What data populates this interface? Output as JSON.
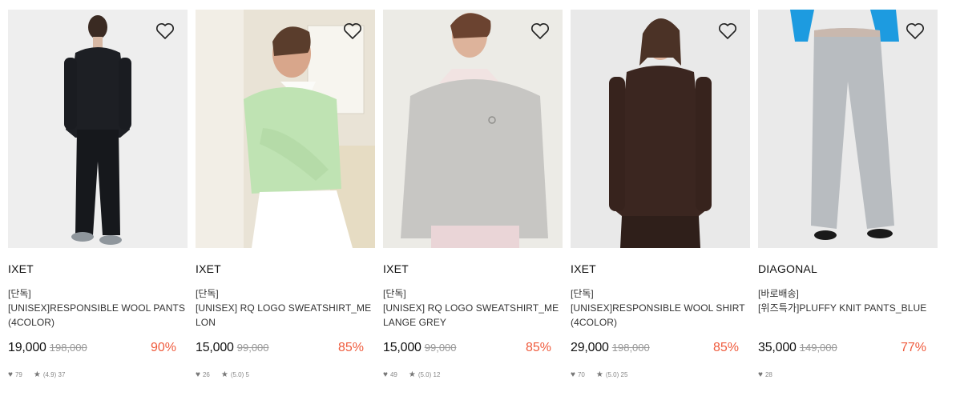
{
  "products": [
    {
      "brand": "IXET",
      "tag": "[단독]",
      "name": "[UNISEX]RESPONSIBLE WOOL PANTS (4COLOR)",
      "price": "19,000",
      "original_price": "198,000",
      "discount": "90%",
      "likes": "79",
      "rating": "(4.9)",
      "reviews": "37",
      "image": "model in black shirt and black wool pants"
    },
    {
      "brand": "IXET",
      "tag": "[단독]",
      "name": "[UNISEX] RQ LOGO SWEATSHIRT_MELON",
      "price": "15,000",
      "original_price": "99,000",
      "discount": "85%",
      "likes": "26",
      "rating": "(5.0)",
      "reviews": "5",
      "image": "model in melon green sweatshirt with white collar"
    },
    {
      "brand": "IXET",
      "tag": "[단독]",
      "name": "[UNISEX] RQ LOGO SWEATSHIRT_MELANGE GREY",
      "price": "15,000",
      "original_price": "99,000",
      "discount": "85%",
      "likes": "49",
      "rating": "(5.0)",
      "reviews": "12",
      "image": "model in melange grey sweatshirt"
    },
    {
      "brand": "IXET",
      "tag": "[단독]",
      "name": "[UNISEX]RESPONSIBLE WOOL SHIRT (4COLOR)",
      "price": "29,000",
      "original_price": "198,000",
      "discount": "85%",
      "likes": "70",
      "rating": "(5.0)",
      "reviews": "25",
      "image": "model in brown wool shirt"
    },
    {
      "brand": "DIAGONAL",
      "tag": "[바로배송]",
      "name": "[위즈특가]PLUFFY KNIT PANTS_BLUE",
      "price": "35,000",
      "original_price": "149,000",
      "discount": "77%",
      "likes": "28",
      "rating": "",
      "reviews": "",
      "image": "blue boucle knit pants"
    }
  ],
  "icons": {
    "like": "heart-icon",
    "rating": "star-icon",
    "wishlist": "heart-outline-icon"
  },
  "colors": {
    "discount": "#ef5b3d"
  }
}
